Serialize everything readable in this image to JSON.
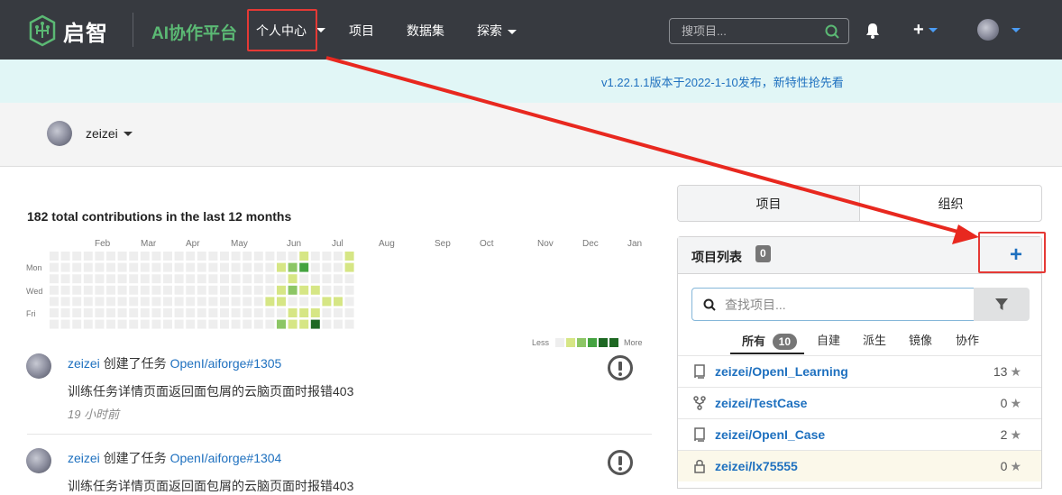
{
  "header": {
    "logo_text": "启智",
    "brand": "AI协作平台",
    "nav": [
      "个人中心",
      "项目",
      "数据集",
      "探索"
    ],
    "search_placeholder": "搜项目..."
  },
  "banner": {
    "text": "v1.22.1.1版本于2022-1-10发布，新特性抢先看"
  },
  "user": {
    "name": "zeizei"
  },
  "contributions": {
    "title": "182 total contributions in the last 12 months",
    "months": [
      "Feb",
      "Mar",
      "Apr",
      "May",
      "Jun",
      "Jul",
      "Aug",
      "Sep",
      "Oct",
      "Nov",
      "Dec",
      "Jan"
    ],
    "days": [
      "Mon",
      "Wed",
      "Fri"
    ],
    "legend_less": "Less",
    "legend_more": "More",
    "colors": [
      "#eeeeee",
      "#d6e685",
      "#8cc665",
      "#44a340",
      "#1e6823"
    ]
  },
  "feed": [
    {
      "user": "zeizei",
      "action": "创建了任务",
      "link": "OpenI/aiforge#1305",
      "title": "训练任务详情页面返回面包屑的云脑页面时报错403",
      "time": "19 小时前"
    },
    {
      "user": "zeizei",
      "action": "创建了任务",
      "link": "OpenI/aiforge#1304",
      "title": "训练任务详情页面返回面包屑的云脑页面时报错403"
    }
  ],
  "sidebar": {
    "tabs": [
      "项目",
      "组织"
    ],
    "list_title": "项目列表",
    "list_count": "0",
    "search_placeholder": "查找项目...",
    "filters": [
      {
        "label": "所有",
        "count": "10"
      },
      {
        "label": "自建"
      },
      {
        "label": "派生"
      },
      {
        "label": "镜像"
      },
      {
        "label": "协作"
      }
    ],
    "repos": [
      {
        "name": "zeizei/OpenI_Learning",
        "stars": "13",
        "icon": "book-icon"
      },
      {
        "name": "zeizei/TestCase",
        "stars": "0",
        "icon": "fork-icon"
      },
      {
        "name": "zeizei/OpenI_Case",
        "stars": "2",
        "icon": "book-icon"
      },
      {
        "name": "zeizei/lx75555",
        "stars": "0",
        "icon": "lock-icon"
      }
    ]
  }
}
